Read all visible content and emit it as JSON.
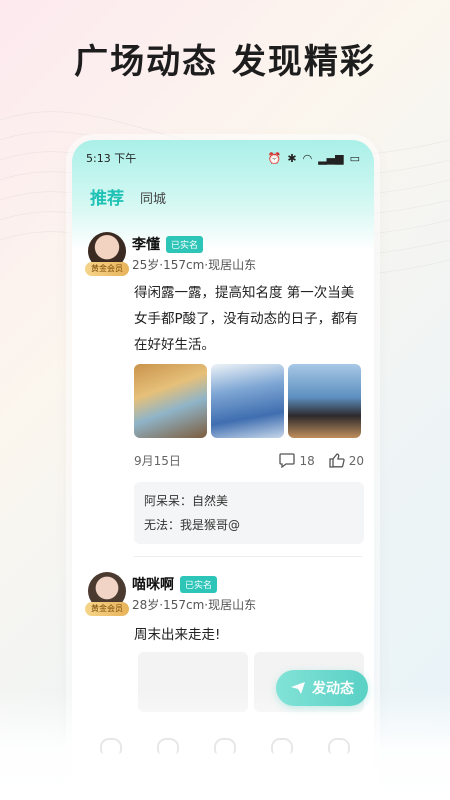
{
  "headline": "广场动态 发现精彩",
  "status": {
    "time": "5:13 下午"
  },
  "tabs": [
    {
      "label": "推荐"
    },
    {
      "label": "同城"
    }
  ],
  "posts": [
    {
      "name": "李懂",
      "verified": "已实名",
      "member": "黄金会员",
      "meta": "25岁·157cm·现居山东",
      "content": "得闲露一露，提高知名度 第一次当美女手都P酸了，没有动态的日子，都有在好好生活。",
      "date": "9月15日",
      "comment_count": "18",
      "like_count": "20",
      "comments": [
        {
          "user": "阿呆呆：",
          "text": "自然美"
        },
        {
          "user": "无法：",
          "text": "我是猴哥@"
        }
      ]
    },
    {
      "name": "喵咪啊",
      "verified": "已实名",
      "member": "黄金会员",
      "meta": "28岁·157cm·现居山东",
      "content": "周末出来走走!"
    }
  ],
  "fab": {
    "label": "发动态"
  },
  "colors": {
    "accent": "#2cc5b8",
    "gold": "#e8b35a"
  }
}
